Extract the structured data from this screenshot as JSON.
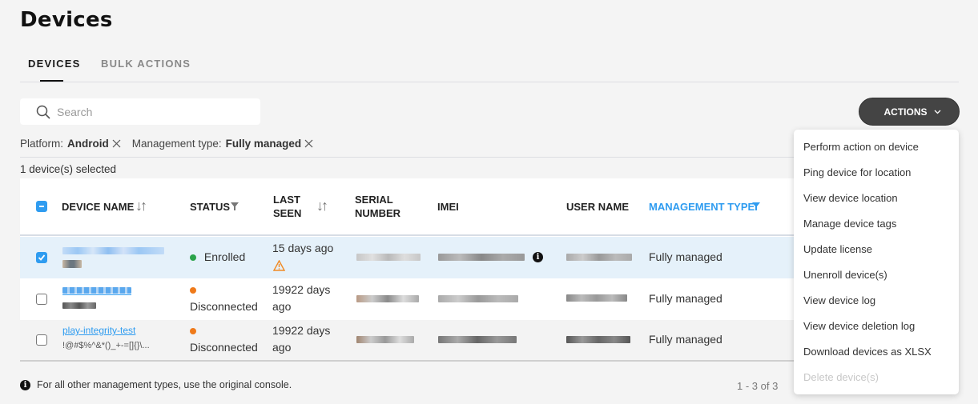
{
  "page": {
    "title": "Devices"
  },
  "tabs": [
    {
      "label": "DEVICES",
      "active": true
    },
    {
      "label": "BULK ACTIONS",
      "active": false
    }
  ],
  "search": {
    "placeholder": "Search",
    "value": ""
  },
  "actions_button": {
    "label": "ACTIONS",
    "icon": "chevron-down-icon"
  },
  "filters": [
    {
      "label": "Platform:",
      "value": "Android"
    },
    {
      "label": "Management type:",
      "value": "Fully managed"
    }
  ],
  "selection": {
    "text": "1 device(s) selected"
  },
  "table": {
    "columns": [
      {
        "label": "DEVICE NAME",
        "sortable": true
      },
      {
        "label": "STATUS",
        "filterable": true
      },
      {
        "label": "LAST\nSEEN",
        "line1": "LAST",
        "line2": "SEEN",
        "sortable": true
      },
      {
        "label": "SERIAL NUMBER",
        "line1": "SERIAL",
        "line2": "NUMBER"
      },
      {
        "label": "IMEI"
      },
      {
        "label": "USER NAME"
      },
      {
        "label": "MANAGEMENT TYPE",
        "filterable": true,
        "active_filter": true
      }
    ],
    "rows": [
      {
        "selected": true,
        "device_name": "[redacted]",
        "device_subtitle": "[redacted]",
        "status": "Enrolled",
        "status_color": "#2aa34a",
        "last_seen": "15 days ago",
        "last_seen_warning": true,
        "serial_number": "[redacted]",
        "imei": "[redacted]",
        "imei_info": true,
        "user_name": "[redacted]",
        "management_type": "Fully managed"
      },
      {
        "selected": false,
        "device_name": "[redacted]",
        "device_subtitle": "[redacted]",
        "status": "Disconnected",
        "status_color": "#ef7a1a",
        "last_seen_1": "19922 days",
        "last_seen_2": "ago",
        "serial_number": "[redacted]",
        "imei": "[redacted]",
        "user_name": "[redacted]",
        "management_type": "Fully managed"
      },
      {
        "selected": false,
        "device_name": "play-integrity-test",
        "device_subtitle": "!@#$%^&*()_+-=[]{}\\...",
        "status": "Disconnected",
        "status_color": "#ef7a1a",
        "last_seen_1": "19922 days",
        "last_seen_2": "ago",
        "serial_number": "[redacted]",
        "imei": "[redacted]",
        "user_name": "[redacted]",
        "management_type": "Fully managed"
      }
    ]
  },
  "footer": {
    "note": "For all other management types, use the original console.",
    "pagination": "1 - 3 of 3"
  },
  "actions_menu": {
    "items": [
      {
        "label": "Perform action on device",
        "disabled": false
      },
      {
        "label": "Ping device for location",
        "disabled": false
      },
      {
        "label": "View device location",
        "disabled": false
      },
      {
        "label": "Manage device tags",
        "disabled": false
      },
      {
        "label": "Update license",
        "disabled": false
      },
      {
        "label": "Unenroll device(s)",
        "disabled": false
      },
      {
        "label": "View device log",
        "disabled": false
      },
      {
        "label": "View device deletion log",
        "disabled": false
      },
      {
        "label": "Download devices as XLSX",
        "disabled": false
      },
      {
        "label": "Delete device(s)",
        "disabled": true
      }
    ]
  },
  "colors": {
    "accent": "#2f9cf0",
    "enrolled": "#2aa34a",
    "disconnected": "#ef7a1a",
    "warning": "#f08a24",
    "actions_button_bg": "#444444"
  }
}
